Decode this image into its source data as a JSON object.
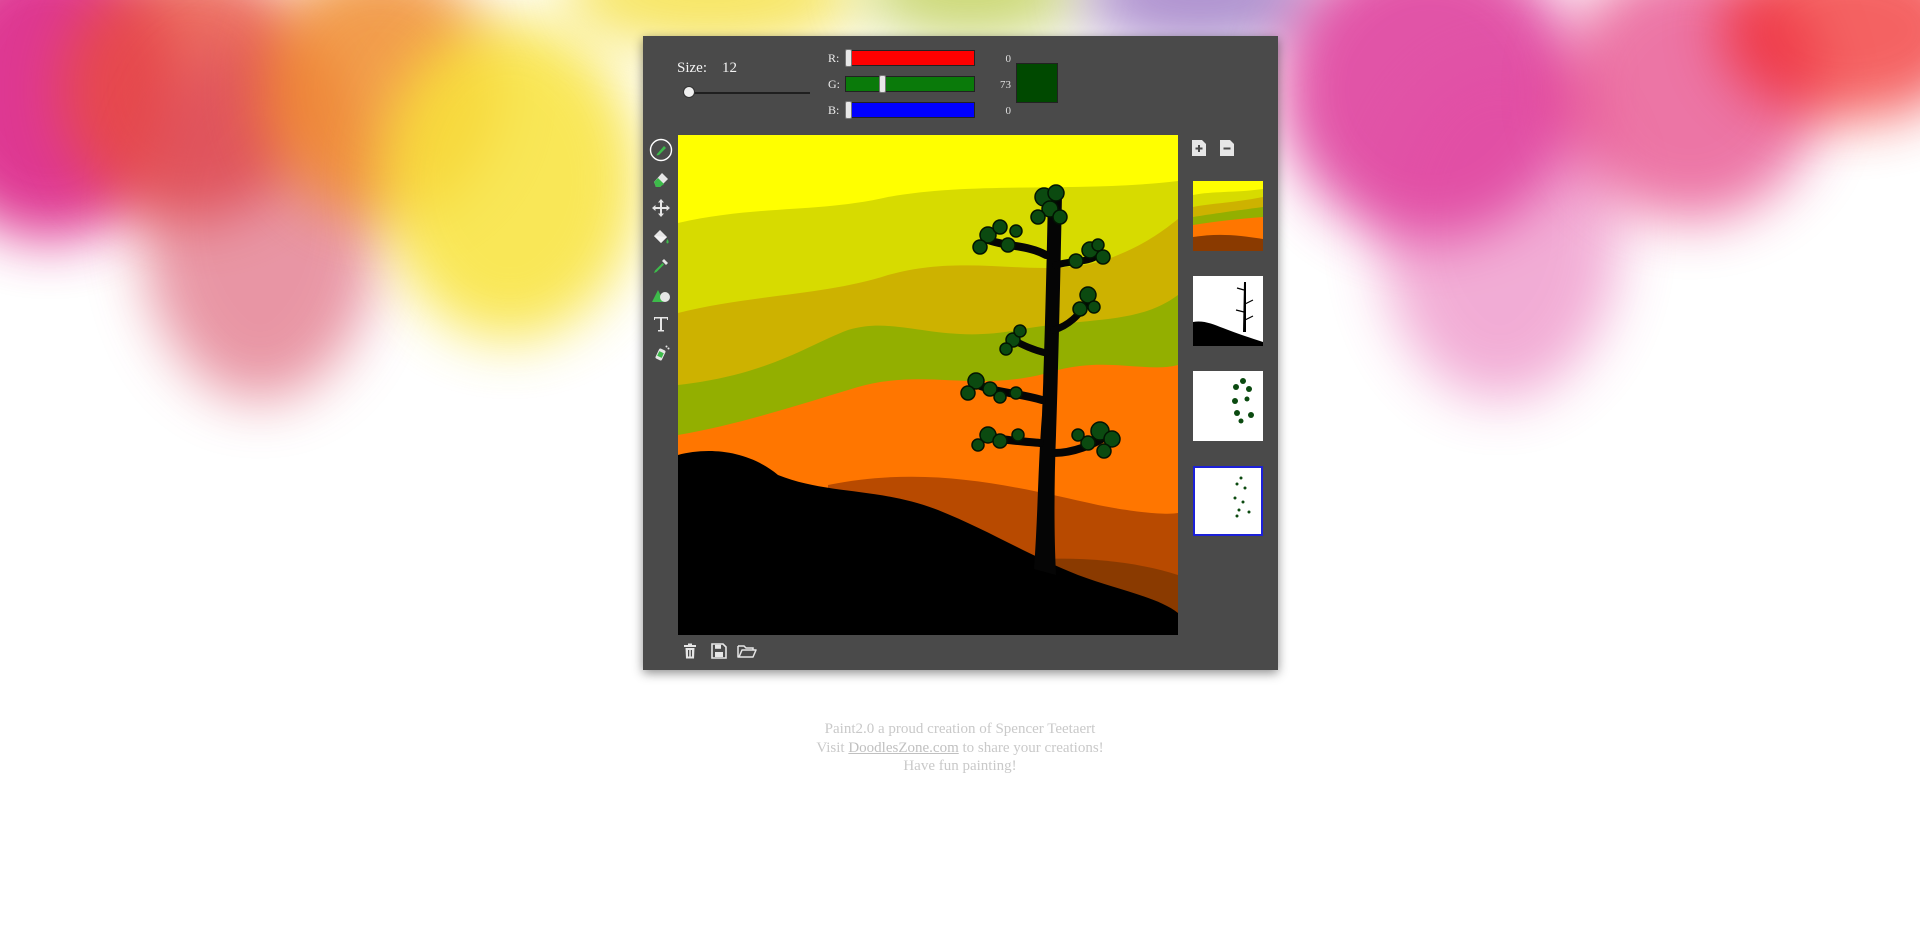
{
  "brush": {
    "size_label": "Size:",
    "size_value": "12"
  },
  "color": {
    "r_label": "R:",
    "r_value": "0",
    "g_label": "G:",
    "g_value": "73",
    "b_label": "B:",
    "b_value": "0",
    "current_hex": "#004900",
    "track_colors": {
      "r": "#ff0000",
      "g": "#0a7a0a",
      "b": "#0000ff"
    }
  },
  "tools": [
    {
      "name": "pencil-tool",
      "icon": "pencil-icon",
      "active": true
    },
    {
      "name": "eraser-tool",
      "icon": "eraser-icon",
      "active": false
    },
    {
      "name": "move-tool",
      "icon": "move-arrows-icon",
      "active": false
    },
    {
      "name": "fill-tool",
      "icon": "paint-bucket-icon",
      "active": false
    },
    {
      "name": "eyedropper-tool",
      "icon": "eyedropper-icon",
      "active": false
    },
    {
      "name": "shapes-tool",
      "icon": "shapes-icon",
      "active": false
    },
    {
      "name": "text-tool",
      "icon": "text-t-icon",
      "active": false
    },
    {
      "name": "spray-tool",
      "icon": "spray-can-icon",
      "active": false
    }
  ],
  "layers": {
    "add_icon": "add-layer-icon",
    "remove_icon": "remove-layer-icon",
    "items": [
      {
        "name": "layer-background",
        "selected": false
      },
      {
        "name": "layer-tree-trunk",
        "selected": false
      },
      {
        "name": "layer-leaves-1",
        "selected": false
      },
      {
        "name": "layer-leaves-2",
        "selected": true
      }
    ]
  },
  "actions": [
    {
      "name": "clear-button",
      "icon": "trash-icon"
    },
    {
      "name": "save-button",
      "icon": "floppy-disk-icon"
    },
    {
      "name": "open-button",
      "icon": "folder-open-icon"
    }
  ],
  "footer": {
    "line1": "Paint2.0 a proud creation of Spencer Teetaert",
    "line2_prefix": "Visit ",
    "link_text": "DoodlesZone.com",
    "line2_suffix": " to share your creations!",
    "line3": "Have fun painting!"
  }
}
